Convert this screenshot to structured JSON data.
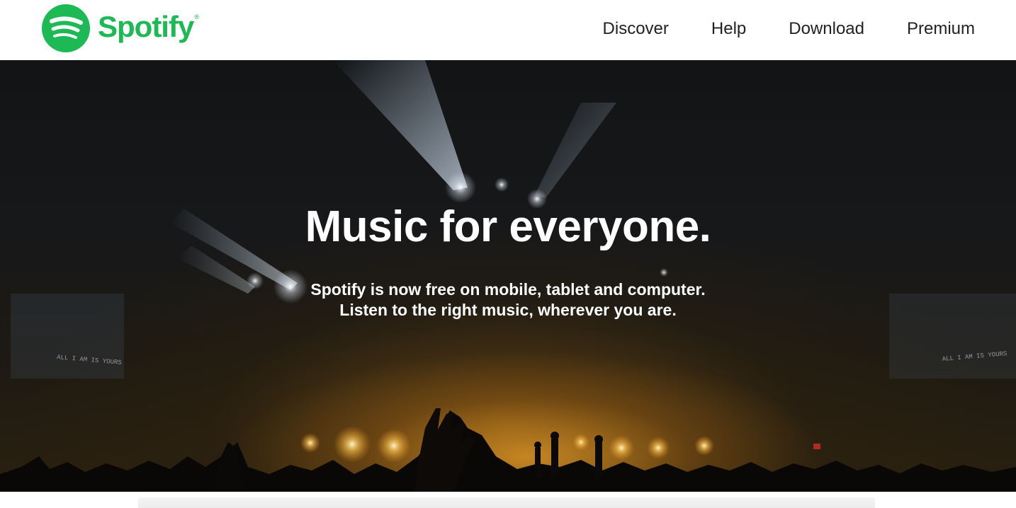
{
  "header": {
    "brand": "Spotify",
    "nav": [
      {
        "label": "Discover"
      },
      {
        "label": "Help"
      },
      {
        "label": "Download"
      },
      {
        "label": "Premium"
      }
    ]
  },
  "hero": {
    "title": "Music for everyone.",
    "subtitle_line1": "Spotify is now free on mobile, tablet and computer.",
    "subtitle_line2": "Listen to the right music, wherever you are.",
    "screen_text_left": "ALL I AM IS YOURS",
    "screen_text_right": "ALL I AM IS YOURS"
  },
  "colors": {
    "brand_green": "#1DB954",
    "nav_text": "#222222",
    "hero_text": "#FFFFFF"
  }
}
